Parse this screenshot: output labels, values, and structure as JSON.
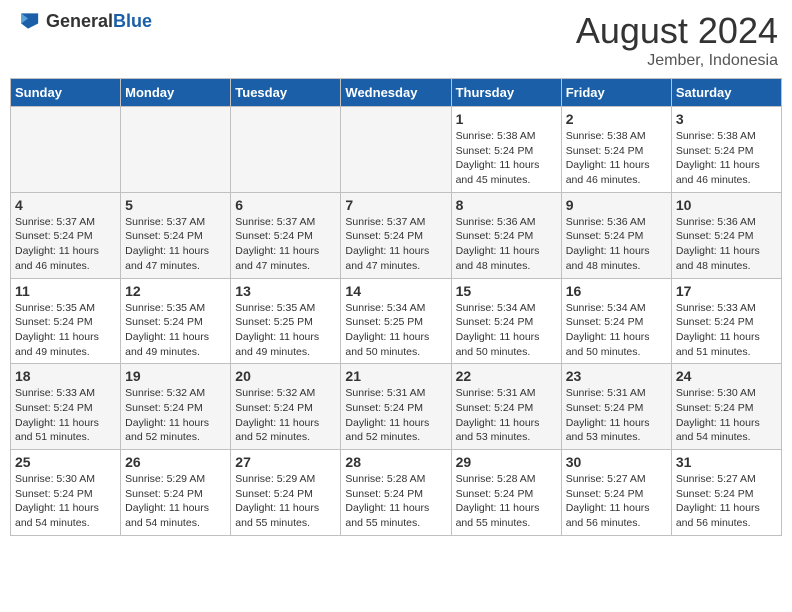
{
  "header": {
    "logo_general": "General",
    "logo_blue": "Blue",
    "month_year": "August 2024",
    "location": "Jember, Indonesia"
  },
  "days_of_week": [
    "Sunday",
    "Monday",
    "Tuesday",
    "Wednesday",
    "Thursday",
    "Friday",
    "Saturday"
  ],
  "weeks": [
    [
      {
        "day": "",
        "info": "",
        "empty": true
      },
      {
        "day": "",
        "info": "",
        "empty": true
      },
      {
        "day": "",
        "info": "",
        "empty": true
      },
      {
        "day": "",
        "info": "",
        "empty": true
      },
      {
        "day": "1",
        "info": "Sunrise: 5:38 AM\nSunset: 5:24 PM\nDaylight: 11 hours\nand 45 minutes."
      },
      {
        "day": "2",
        "info": "Sunrise: 5:38 AM\nSunset: 5:24 PM\nDaylight: 11 hours\nand 46 minutes."
      },
      {
        "day": "3",
        "info": "Sunrise: 5:38 AM\nSunset: 5:24 PM\nDaylight: 11 hours\nand 46 minutes."
      }
    ],
    [
      {
        "day": "4",
        "info": "Sunrise: 5:37 AM\nSunset: 5:24 PM\nDaylight: 11 hours\nand 46 minutes."
      },
      {
        "day": "5",
        "info": "Sunrise: 5:37 AM\nSunset: 5:24 PM\nDaylight: 11 hours\nand 47 minutes."
      },
      {
        "day": "6",
        "info": "Sunrise: 5:37 AM\nSunset: 5:24 PM\nDaylight: 11 hours\nand 47 minutes."
      },
      {
        "day": "7",
        "info": "Sunrise: 5:37 AM\nSunset: 5:24 PM\nDaylight: 11 hours\nand 47 minutes."
      },
      {
        "day": "8",
        "info": "Sunrise: 5:36 AM\nSunset: 5:24 PM\nDaylight: 11 hours\nand 48 minutes."
      },
      {
        "day": "9",
        "info": "Sunrise: 5:36 AM\nSunset: 5:24 PM\nDaylight: 11 hours\nand 48 minutes."
      },
      {
        "day": "10",
        "info": "Sunrise: 5:36 AM\nSunset: 5:24 PM\nDaylight: 11 hours\nand 48 minutes."
      }
    ],
    [
      {
        "day": "11",
        "info": "Sunrise: 5:35 AM\nSunset: 5:24 PM\nDaylight: 11 hours\nand 49 minutes."
      },
      {
        "day": "12",
        "info": "Sunrise: 5:35 AM\nSunset: 5:24 PM\nDaylight: 11 hours\nand 49 minutes."
      },
      {
        "day": "13",
        "info": "Sunrise: 5:35 AM\nSunset: 5:25 PM\nDaylight: 11 hours\nand 49 minutes."
      },
      {
        "day": "14",
        "info": "Sunrise: 5:34 AM\nSunset: 5:25 PM\nDaylight: 11 hours\nand 50 minutes."
      },
      {
        "day": "15",
        "info": "Sunrise: 5:34 AM\nSunset: 5:24 PM\nDaylight: 11 hours\nand 50 minutes."
      },
      {
        "day": "16",
        "info": "Sunrise: 5:34 AM\nSunset: 5:24 PM\nDaylight: 11 hours\nand 50 minutes."
      },
      {
        "day": "17",
        "info": "Sunrise: 5:33 AM\nSunset: 5:24 PM\nDaylight: 11 hours\nand 51 minutes."
      }
    ],
    [
      {
        "day": "18",
        "info": "Sunrise: 5:33 AM\nSunset: 5:24 PM\nDaylight: 11 hours\nand 51 minutes."
      },
      {
        "day": "19",
        "info": "Sunrise: 5:32 AM\nSunset: 5:24 PM\nDaylight: 11 hours\nand 52 minutes."
      },
      {
        "day": "20",
        "info": "Sunrise: 5:32 AM\nSunset: 5:24 PM\nDaylight: 11 hours\nand 52 minutes."
      },
      {
        "day": "21",
        "info": "Sunrise: 5:31 AM\nSunset: 5:24 PM\nDaylight: 11 hours\nand 52 minutes."
      },
      {
        "day": "22",
        "info": "Sunrise: 5:31 AM\nSunset: 5:24 PM\nDaylight: 11 hours\nand 53 minutes."
      },
      {
        "day": "23",
        "info": "Sunrise: 5:31 AM\nSunset: 5:24 PM\nDaylight: 11 hours\nand 53 minutes."
      },
      {
        "day": "24",
        "info": "Sunrise: 5:30 AM\nSunset: 5:24 PM\nDaylight: 11 hours\nand 54 minutes."
      }
    ],
    [
      {
        "day": "25",
        "info": "Sunrise: 5:30 AM\nSunset: 5:24 PM\nDaylight: 11 hours\nand 54 minutes."
      },
      {
        "day": "26",
        "info": "Sunrise: 5:29 AM\nSunset: 5:24 PM\nDaylight: 11 hours\nand 54 minutes."
      },
      {
        "day": "27",
        "info": "Sunrise: 5:29 AM\nSunset: 5:24 PM\nDaylight: 11 hours\nand 55 minutes."
      },
      {
        "day": "28",
        "info": "Sunrise: 5:28 AM\nSunset: 5:24 PM\nDaylight: 11 hours\nand 55 minutes."
      },
      {
        "day": "29",
        "info": "Sunrise: 5:28 AM\nSunset: 5:24 PM\nDaylight: 11 hours\nand 55 minutes."
      },
      {
        "day": "30",
        "info": "Sunrise: 5:27 AM\nSunset: 5:24 PM\nDaylight: 11 hours\nand 56 minutes."
      },
      {
        "day": "31",
        "info": "Sunrise: 5:27 AM\nSunset: 5:24 PM\nDaylight: 11 hours\nand 56 minutes."
      }
    ]
  ]
}
